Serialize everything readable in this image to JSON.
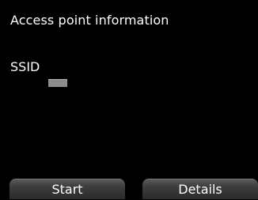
{
  "screen": {
    "title": "Access point information",
    "ssid_label": "SSID",
    "ssid_value_masked": true
  },
  "softkeys": {
    "left_label": "Start",
    "right_label": "Details"
  },
  "colors": {
    "background": "#000000",
    "text": "#ffffff",
    "mask": "#8c8c8c"
  }
}
